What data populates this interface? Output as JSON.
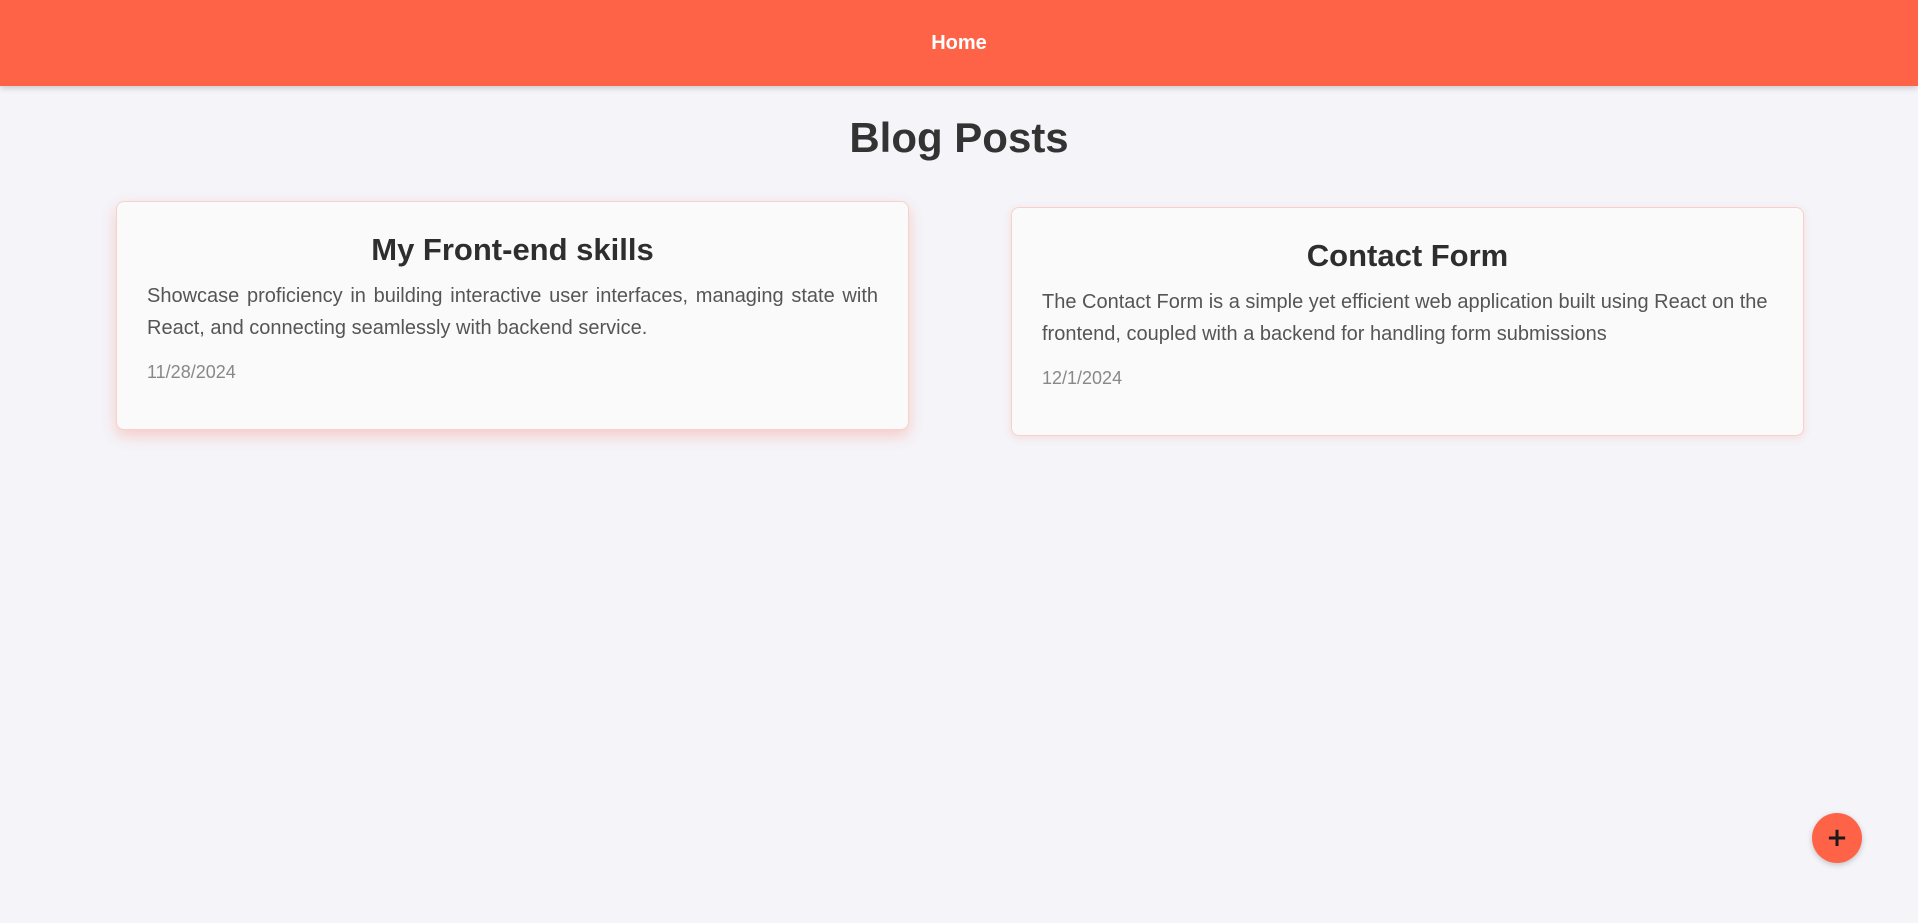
{
  "nav": {
    "home_label": "Home"
  },
  "page": {
    "title": "Blog Posts"
  },
  "posts": [
    {
      "title": "My Front-end skills",
      "body": "Showcase proficiency in building interactive user interfaces, managing state with React, and connecting seamlessly with backend service.",
      "date": "11/28/2024"
    },
    {
      "title": "Contact Form",
      "body": "The Contact Form is a simple yet efficient web application built using React on the frontend, coupled with a backend for handling form submissions",
      "date": "12/1/2024"
    }
  ],
  "fab": {
    "icon": "plus-icon",
    "glyph": "+"
  },
  "colors": {
    "accent": "#ff6347",
    "background": "#f4f4f9",
    "card": "#fafafa"
  }
}
